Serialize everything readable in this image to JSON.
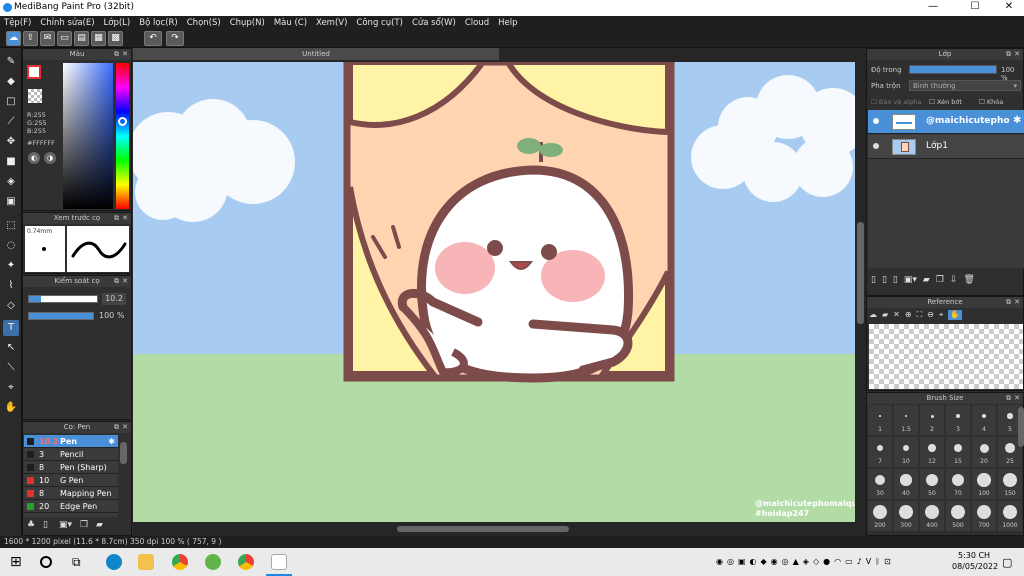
{
  "window": {
    "title": "MediBang Paint Pro (32bit)",
    "minimize": "—",
    "maximize": "☐",
    "close": "✕"
  },
  "menu": [
    "Tệp(F)",
    "Chỉnh sửa(E)",
    "Lớp(L)",
    "Bộ lọc(R)",
    "Chọn(S)",
    "Chụp(N)",
    "Màu (C)",
    "Xem(V)",
    "Công cụ(T)",
    "Cửa sổ(W)",
    "Cloud",
    "Help"
  ],
  "panels": {
    "color": {
      "title": "Màu",
      "r": "R:255",
      "g": "G:255",
      "b": "B:255",
      "hex": "#FFFFFF"
    },
    "brush_preview": {
      "title": "Xem trước cọ",
      "size": "0.74mm"
    },
    "brush_control": {
      "title": "Kiểm soát cọ",
      "size_value": "10.2",
      "opacity_value": "100 %",
      "opacity_fraction": 1.0
    },
    "brush_list": {
      "title": "Cọ: Pen",
      "items": [
        {
          "size": "10.2",
          "name": "Pen",
          "color": "#1e1e1e",
          "selected": true
        },
        {
          "size": "3",
          "name": "Pencil",
          "color": "#1e1e1e"
        },
        {
          "size": "8",
          "name": "Pen (Sharp)",
          "color": "#1e1e1e"
        },
        {
          "size": "10",
          "name": "G Pen",
          "color": "#e03030"
        },
        {
          "size": "8",
          "name": "Mapping Pen",
          "color": "#e03030"
        },
        {
          "size": "20",
          "name": "Edge Pen",
          "color": "#2aa02a"
        }
      ]
    },
    "layer": {
      "title": "Lớp",
      "opacity_label": "Độ trong",
      "opacity_value": "100 %",
      "opacity_fraction": 1.0,
      "blend_label": "Pha trộn",
      "blend_value": "Bình thường",
      "protect_alpha": "Bảo vệ alpha",
      "clipping": "Xén bớt",
      "lock": "Khóa",
      "layers": [
        {
          "name": "@maichicutepho",
          "selected": true
        },
        {
          "name": "Lớp1",
          "selected": false
        }
      ]
    },
    "reference": {
      "title": "Reference"
    },
    "brush_size": {
      "title": "Brush Size",
      "sizes": [
        "1",
        "1.5",
        "2",
        "3",
        "4",
        "5",
        "7",
        "10",
        "12",
        "15",
        "20",
        "25",
        "30",
        "40",
        "50",
        "70",
        "100",
        "150",
        "200",
        "300",
        "400",
        "500",
        "700",
        "1000"
      ]
    }
  },
  "canvas": {
    "tab_title": "Untitled",
    "watermark_line1": "@maichicutephomaique",
    "watermark_line2": "#hoidap247"
  },
  "status": {
    "text": "1600 * 1200 pixel   (11.6 * 8.7cm)   350 dpi   100 %   ( 757, 9 )"
  },
  "taskbar": {
    "time": "5:30 CH",
    "date": "08/05/2022"
  },
  "colors": {
    "accent": "#4a90d9",
    "sky": "#a7cbf1",
    "grass": "#b3dba6",
    "outline": "#7d4b4a"
  }
}
